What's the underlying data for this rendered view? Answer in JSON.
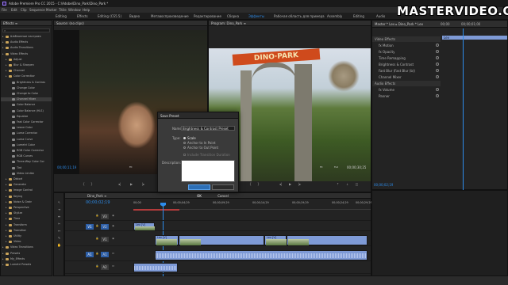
{
  "titlebar": {
    "title": "Adobe Premiere Pro CC 2015 - C:\\Adobe\\Dino_Park\\Dino_Park *"
  },
  "window_controls": [
    "–",
    "□",
    "✕"
  ],
  "watermark": "MASTERVIDEO.ORG",
  "menu": [
    "File",
    "Edit",
    "Clip",
    "Sequence",
    "Marker",
    "Titile",
    "Window",
    "Help"
  ],
  "workspaces": [
    "Editing",
    "Effects",
    "Editing (CS5.5)",
    "Видео",
    "Метавоспроизведение",
    "Редактирование",
    "Сборка",
    "Эффекты",
    "Рабочая область для примера",
    "Assembly",
    "Editing",
    "Audio"
  ],
  "effects_panel": {
    "tab": "Effects ≡",
    "tree": [
      "Шаблонные настроек",
      "Audio Effects",
      "Audio Transitions",
      "Video Effects",
      "Adjust",
      "Blur & Sharpen",
      "Channel",
      "Color Correction",
      "Brightness & Contras",
      "Change Color",
      "Change to Color",
      "Channel Mixer",
      "Color Balance",
      "Color Balance (HLS)",
      "Equalize",
      "Fast Color Corrector",
      "Leave Color",
      "Luma Corrector",
      "Luma Curve",
      "Lumetri Color",
      "RGB Color Corrector",
      "RGB Curves",
      "Three-Way Color Cor",
      "Tint",
      "Video Limiter",
      "Distort",
      "Generate",
      "Image Control",
      "Keying",
      "Noise & Grain",
      "Perspective",
      "Stylize",
      "Time",
      "Transform",
      "Transition",
      "Utility",
      "Video",
      "Video Transitions",
      "Presets",
      "My_Effects",
      "Lumetri Presets"
    ]
  },
  "source_monitor": {
    "tab": "Source: (no clips)",
    "timecode": "00;00;11;19",
    "zoom": "Fit",
    "duration": "00;00;17;09"
  },
  "program_monitor": {
    "tab": "Program: Dino_Park ≡",
    "timecode": "00;00;02;19",
    "zoom": "Fit",
    "full": "Full",
    "duration": "00;00;30;25",
    "sign": "DINO·PARK"
  },
  "effect_controls": {
    "header": "Master * Lev  ▸ Dino_Park * Lev",
    "clip_label": "Lev",
    "timecodes": [
      "00;00",
      "00;00;01;00"
    ],
    "rows": [
      "Video Effects",
      "fx Motion",
      "fx Opacity",
      "Time Remapping",
      "Brightness & Contrast",
      "Fast Blur (Fast Blur (b))",
      "Channel Mixer",
      "Audio Effects",
      "fx Volume",
      "Panner"
    ],
    "current_time": "00;00;02;19"
  },
  "dialog": {
    "title": "Save Preset",
    "name_label": "Name:",
    "name_value": "Brightness & Contrast Preset",
    "type_label": "Type:",
    "options": [
      "Scale",
      "Anchor to In Point",
      "Anchor to Out Point"
    ],
    "checkbox": "Include Transition Duration",
    "description_label": "Description:",
    "ok": "OK",
    "cancel": "Cancel"
  },
  "timeline": {
    "tab": "Dino_Park ≡",
    "timecode": "00;00;02;19",
    "ruler": [
      "00;00",
      "00;00;04;29",
      "00;00;09;29",
      "00;00;14;29",
      "00;00;19;29",
      "00;00;24;29",
      "00;00;29;29"
    ],
    "tracks": [
      {
        "patch": "",
        "name": "V3"
      },
      {
        "patch": "V1",
        "name": "V2"
      },
      {
        "patch": "",
        "name": "V1"
      },
      {
        "patch": "A1",
        "name": "A1"
      },
      {
        "patch": "",
        "name": "A2"
      }
    ],
    "clips": {
      "v2_first": "Lev [V]",
      "v1_a": "Lev [V]",
      "v1_b": "Lev [V]"
    }
  },
  "colors": {
    "accent": "#2d8ceb",
    "clip": "#7e9ad6",
    "playhead": "#2d8ceb",
    "dialog": "#3a3a3a"
  }
}
